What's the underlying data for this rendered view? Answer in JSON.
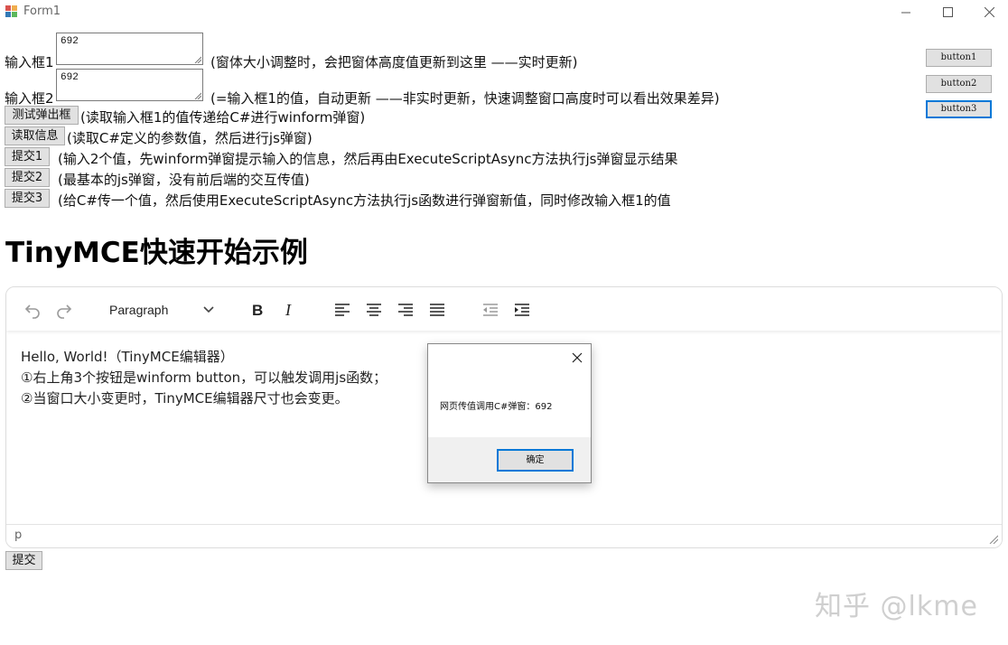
{
  "window": {
    "title": "Form1"
  },
  "form": {
    "input1": {
      "label": "输入框1",
      "value": "692",
      "note": "(窗体大小调整时，会把窗体高度值更新到这里 ——实时更新)"
    },
    "input2": {
      "label": "输入框2",
      "value": "692",
      "note": "(=输入框1的值，自动更新 ——非实时更新，快速调整窗口高度时可以看出效果差异)"
    },
    "test_popup": {
      "label": "测试弹出框",
      "note": "(读取输入框1的值传递给C#进行winform弹窗)"
    },
    "read_info": {
      "label": "读取信息",
      "note": "(读取C#定义的参数值，然后进行js弹窗)"
    },
    "submit1": {
      "label": "提交1",
      "note": "(输入2个值，先winform弹窗提示输入的信息，然后再由ExecuteScriptAsync方法执行js弹窗显示结果"
    },
    "submit2": {
      "label": "提交2",
      "note": "(最基本的js弹窗，没有前后端的交互传值)"
    },
    "submit3": {
      "label": "提交3",
      "note": "(给C#传一个值，然后使用ExecuteScriptAsync方法执行js函数进行弹窗新值，同时修改输入框1的值"
    }
  },
  "right_buttons": [
    "button1",
    "button2",
    "button3"
  ],
  "heading": "TinyMCE快速开始示例",
  "editor": {
    "block_format": "Paragraph",
    "icons": [
      "undo-icon",
      "redo-icon",
      "bold-icon",
      "italic-icon",
      "align-left-icon",
      "align-center-icon",
      "align-right-icon",
      "align-justify-icon",
      "outdent-icon",
      "indent-icon"
    ],
    "lines": [
      "Hello, World!（TinyMCE编辑器）",
      "①右上角3个按钮是winform button，可以触发调用js函数；",
      "②当窗口大小变更时，TinyMCE编辑器尺寸也会变更。"
    ],
    "status_path": "p"
  },
  "dialog": {
    "message": "网页传值调用C#弹窗：692",
    "ok_label": "确定"
  },
  "submit_label": "提交",
  "watermark": "知乎 @lkme",
  "colors": {
    "accent": "#0078d7",
    "button_face": "#e1e1e1",
    "button_border": "#adadad"
  }
}
